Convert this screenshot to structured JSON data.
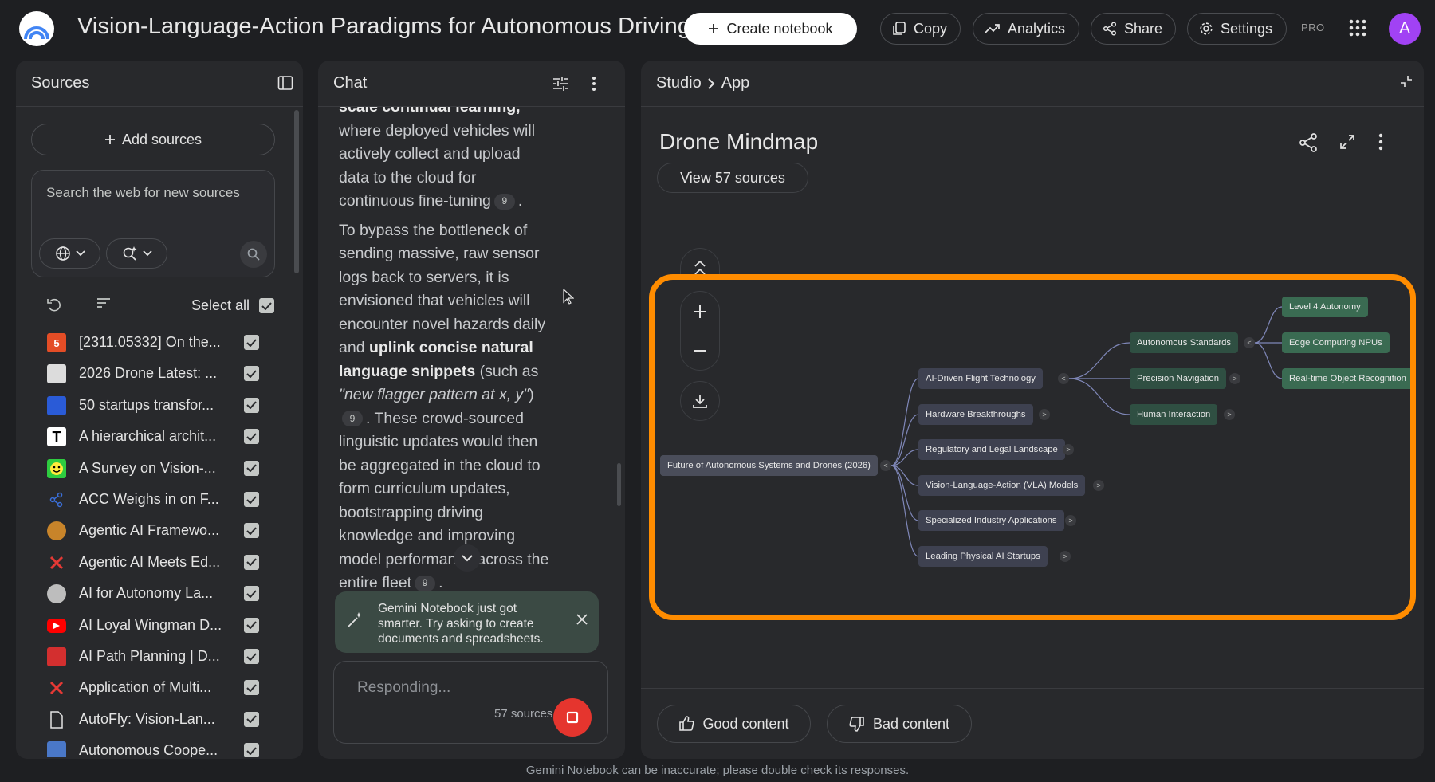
{
  "header": {
    "title": "Vision-Language-Action Paradigms for Autonomous Driving",
    "create_label": "Create notebook",
    "copy_label": "Copy",
    "analytics_label": "Analytics",
    "share_label": "Share",
    "settings_label": "Settings",
    "pro_label": "PRO",
    "avatar_initial": "A"
  },
  "sources": {
    "title": "Sources",
    "add_label": "Add sources",
    "search_placeholder": "Search the web for new sources",
    "select_all_label": "Select all",
    "items": [
      {
        "label": "[2311.05332] On the...",
        "icon": "html5-icon",
        "color": "#e44d26",
        "checked": true
      },
      {
        "label": "2026 Drone Latest: ...",
        "icon": "drone-image-icon",
        "color": "#dcdcdc",
        "checked": true
      },
      {
        "label": "50 startups transfor...",
        "icon": "startups-logo-icon",
        "color": "#2a5bd7",
        "checked": true
      },
      {
        "label": "A hierarchical archit...",
        "icon": "letter-t-icon",
        "color": "#ffffff",
        "checked": true
      },
      {
        "label": "A Survey on Vision-...",
        "icon": "smiley-icon",
        "color": "#2ecc40",
        "checked": true
      },
      {
        "label": "ACC Weighs in on F...",
        "icon": "molecule-icon",
        "color": "#3b6fd8",
        "checked": true
      },
      {
        "label": "Agentic AI Framewo...",
        "icon": "circle-logo-icon",
        "color": "#c8842a",
        "checked": true
      },
      {
        "label": "Agentic AI Meets Ed...",
        "icon": "x-logo-icon",
        "color": "#e53935",
        "checked": true
      },
      {
        "label": "AI for Autonomy La...",
        "icon": "globe-logo-icon",
        "color": "#bdbdbd",
        "checked": true
      },
      {
        "label": "AI Loyal Wingman D...",
        "icon": "youtube-icon",
        "color": "#ff0000",
        "checked": true
      },
      {
        "label": "AI Path Planning | D...",
        "icon": "plane-logo-icon",
        "color": "#d32f2f",
        "checked": true
      },
      {
        "label": "Application of Multi...",
        "icon": "x-logo-icon",
        "color": "#e53935",
        "checked": true
      },
      {
        "label": "AutoFly: Vision-Lan...",
        "icon": "file-icon",
        "color": "#e3e3e3",
        "checked": true
      },
      {
        "label": "Autonomous Coope...",
        "icon": "lock-logo-icon",
        "color": "#4a78c8",
        "checked": true
      }
    ]
  },
  "chat": {
    "title": "Chat",
    "para1_partial": "scale continual learning,",
    "para1_rest": "where deployed vehicles will actively collect and upload data to the cloud for continuous fine-tuning",
    "para1_end": ".",
    "para2_start": "To bypass the bottleneck of sending massive, raw sensor logs back to servers, it is envisioned that vehicles will encounter novel hazards daily and",
    "para2_bold": "uplink concise natural language snippets",
    "para2_mid": "(such as",
    "para2_italic": "\"new flagger pattern at x, y\"",
    "para2_close": ")",
    "para2_rest": ". These crowd-sourced linguistic updates would then be aggregated in the cloud to form curriculum updates, bootstrapping driving knowledge and improving model performance across the entire fleet",
    "para2_end": ".",
    "citation": "9",
    "toast_text": "Gemini Notebook just got smarter. Try asking to create documents and spreadsheets.",
    "composer_placeholder": "Responding...",
    "source_count": "57 sources"
  },
  "studio": {
    "breadcrumb_root": "Studio",
    "breadcrumb_current": "App",
    "mindmap_title": "Drone Mindmap",
    "view_sources_label": "View 57 sources",
    "mindmap": {
      "root": "Future of Autonomous Systems and Drones (2026)",
      "level1": [
        "AI-Driven Flight Technology",
        "Hardware Breakthroughs",
        "Regulatory and Legal Landscape",
        "Vision-Language-Action (VLA) Models",
        "Specialized Industry Applications",
        "Leading Physical AI Startups"
      ],
      "level2": [
        "Autonomous Standards",
        "Precision Navigation",
        "Human Interaction"
      ],
      "level3": [
        "Level 4 Autonomy",
        "Edge Computing NPUs",
        "Real-time Object Recognition"
      ]
    },
    "good_label": "Good content",
    "bad_label": "Bad content"
  },
  "footer": {
    "disclaimer": "Gemini Notebook can be inaccurate; please double check its responses."
  },
  "colors": {
    "highlight": "#ff8c00",
    "stop_button": "#e5352e",
    "avatar": "#a142f4",
    "background": "#1e1f22",
    "panel": "#28292c"
  }
}
